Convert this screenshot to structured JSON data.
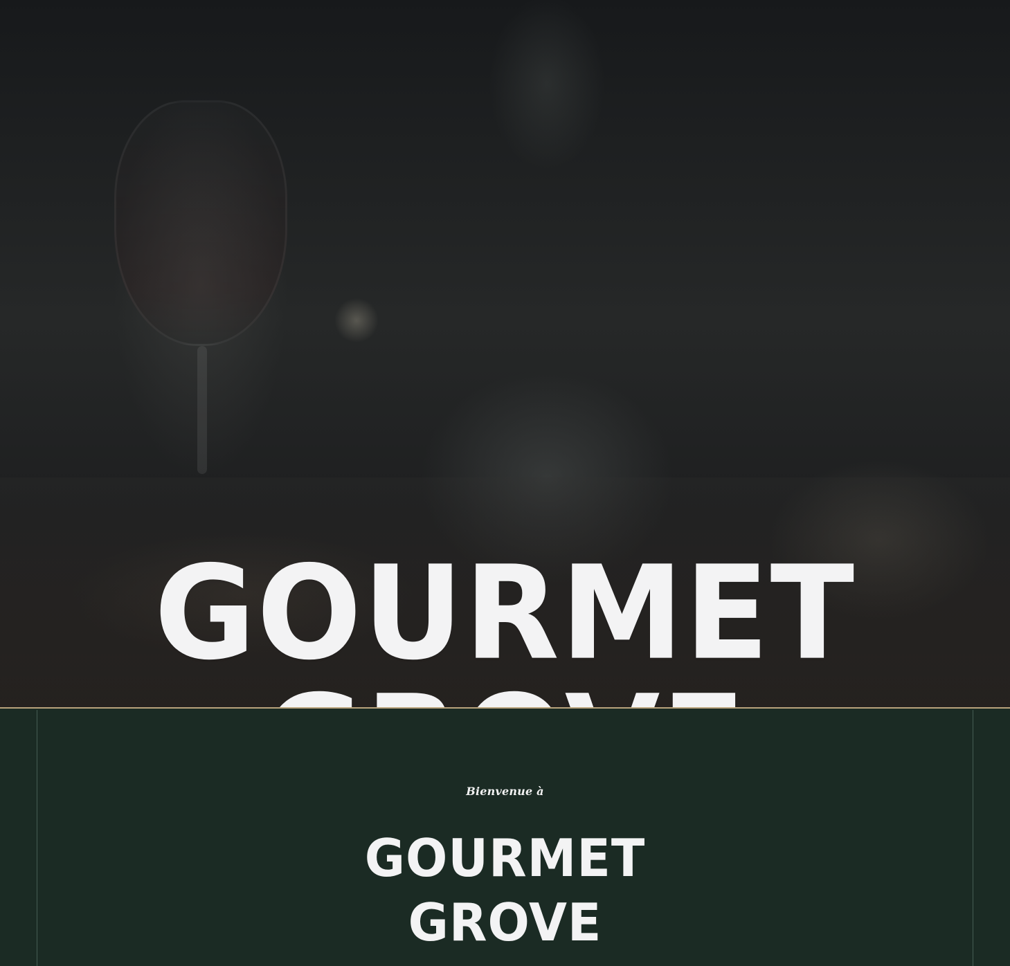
{
  "header": {
    "logo_icon": "gourmet-grove-g-logo-icon",
    "menu_icon": "hamburger-menu-icon",
    "accent_color": "#c5a57a"
  },
  "hero": {
    "title": "GOURMET GROVE",
    "background": "blurred restaurant table scene",
    "title_color": "#f3f3f4"
  },
  "welcome": {
    "kicker": "Bienvenue à",
    "title_line_1": "GOURMET",
    "title_line_2": "GROVE",
    "background_color": "#1b2b24"
  }
}
